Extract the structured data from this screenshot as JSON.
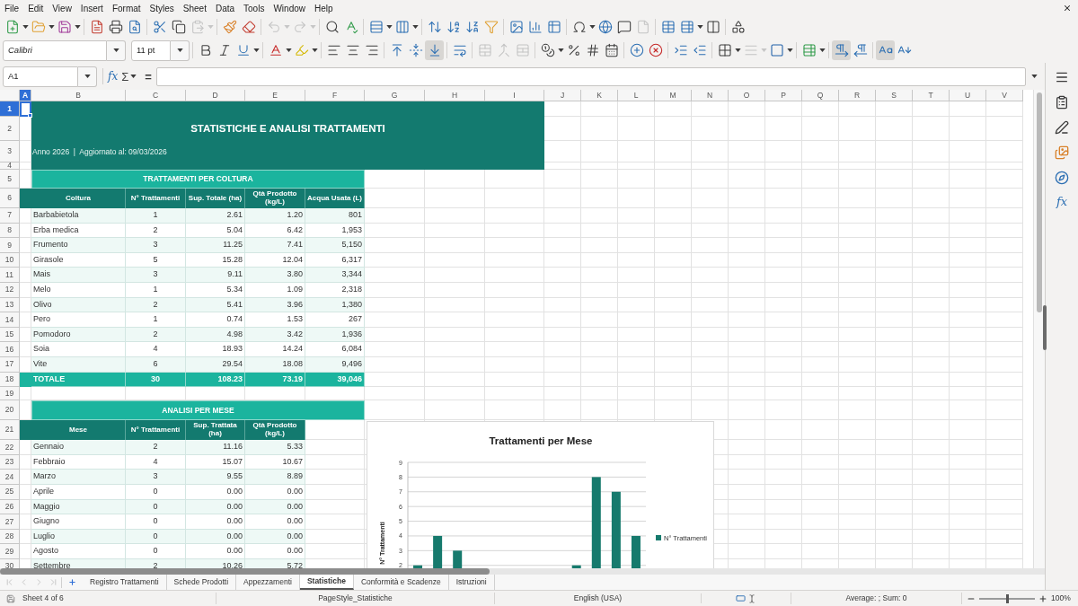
{
  "menu_bar": {
    "items": [
      "File",
      "Edit",
      "View",
      "Insert",
      "Format",
      "Styles",
      "Sheet",
      "Data",
      "Tools",
      "Window",
      "Help"
    ]
  },
  "standard_toolbar": {
    "paste_disabled": true,
    "undo_disabled": true,
    "redo_disabled": true,
    "header_footer_disabled": true
  },
  "formatting_toolbar": {
    "font_name": "Calibri",
    "font_size": "11 pt",
    "align_top_pressed": false,
    "align_center_pressed": false,
    "align_bottom_pressed": true,
    "merge_disabled": true,
    "border_style_disabled": true,
    "left_to_right_pressed": true,
    "right_to_left_pressed": false,
    "horizontal_text_pressed": true,
    "vertical_text_pressed": false
  },
  "formula_bar": {
    "name_box": "A1",
    "function_wizard": "fx",
    "sum": "Σ",
    "equals": "="
  },
  "sidebar": {
    "functions": "fx"
  },
  "column_headers": [
    {
      "label": "A",
      "selected": true
    },
    {
      "label": "B",
      "selected": false
    },
    {
      "label": "C",
      "selected": false
    },
    {
      "label": "D",
      "selected": false
    },
    {
      "label": "E",
      "selected": false
    },
    {
      "label": "F",
      "selected": false
    },
    {
      "label": "G",
      "selected": false
    },
    {
      "label": "H",
      "selected": false
    },
    {
      "label": "I",
      "selected": false
    },
    {
      "label": "J",
      "selected": false
    },
    {
      "label": "K",
      "selected": false
    },
    {
      "label": "L",
      "selected": false
    },
    {
      "label": "M",
      "selected": false
    },
    {
      "label": "N",
      "selected": false
    },
    {
      "label": "O",
      "selected": false
    },
    {
      "label": "P",
      "selected": false
    },
    {
      "label": "Q",
      "selected": false
    },
    {
      "label": "R",
      "selected": false
    },
    {
      "label": "S",
      "selected": false
    },
    {
      "label": "T",
      "selected": false
    },
    {
      "label": "U",
      "selected": false
    },
    {
      "label": "V",
      "selected": false
    }
  ],
  "row_headers": [
    {
      "label": "1",
      "selected": true
    },
    {
      "label": "2",
      "selected": false
    },
    {
      "label": "3",
      "selected": false
    },
    {
      "label": "4",
      "selected": false
    },
    {
      "label": "5",
      "selected": false
    },
    {
      "label": "6",
      "selected": false
    },
    {
      "label": "7",
      "selected": false
    },
    {
      "label": "8",
      "selected": false
    },
    {
      "label": "9",
      "selected": false
    },
    {
      "label": "10",
      "selected": false
    },
    {
      "label": "11",
      "selected": false
    },
    {
      "label": "12",
      "selected": false
    },
    {
      "label": "13",
      "selected": false
    },
    {
      "label": "14",
      "selected": false
    },
    {
      "label": "15",
      "selected": false
    },
    {
      "label": "16",
      "selected": false
    },
    {
      "label": "17",
      "selected": false
    },
    {
      "label": "18",
      "selected": false
    },
    {
      "label": "19",
      "selected": false
    },
    {
      "label": "20",
      "selected": false
    },
    {
      "label": "21",
      "selected": false
    },
    {
      "label": "22",
      "selected": false
    },
    {
      "label": "23",
      "selected": false
    },
    {
      "label": "24",
      "selected": false
    },
    {
      "label": "25",
      "selected": false
    },
    {
      "label": "26",
      "selected": false
    },
    {
      "label": "27",
      "selected": false
    },
    {
      "label": "28",
      "selected": false
    },
    {
      "label": "29",
      "selected": false
    },
    {
      "label": "30",
      "selected": false
    }
  ],
  "sheet": {
    "title": "STATISTICHE E ANALISI TRATTAMENTI",
    "subtitle": "Anno 2026  |  Aggiornato al: 09/03/2026",
    "crop_table": {
      "title": "TRATTAMENTI PER COLTURA",
      "columns": [
        "Coltura",
        "N° Trattamenti",
        "Sup. Totale (ha)",
        "Qtà Prodotto (kg/L)",
        "Acqua Usata (L)"
      ],
      "rows": [
        [
          "Barbabietola",
          "1",
          "2.61",
          "1.20",
          "801"
        ],
        [
          "Erba medica",
          "2",
          "5.04",
          "6.42",
          "1,953"
        ],
        [
          "Frumento",
          "3",
          "11.25",
          "7.41",
          "5,150"
        ],
        [
          "Girasole",
          "5",
          "15.28",
          "12.04",
          "6,317"
        ],
        [
          "Mais",
          "3",
          "9.11",
          "3.80",
          "3,344"
        ],
        [
          "Melo",
          "1",
          "5.34",
          "1.09",
          "2,318"
        ],
        [
          "Olivo",
          "2",
          "5.41",
          "3.96",
          "1,380"
        ],
        [
          "Pero",
          "1",
          "0.74",
          "1.53",
          "267"
        ],
        [
          "Pomodoro",
          "2",
          "4.98",
          "3.42",
          "1,936"
        ],
        [
          "Soia",
          "4",
          "18.93",
          "14.24",
          "6,084"
        ],
        [
          "Vite",
          "6",
          "29.54",
          "18.08",
          "9,496"
        ]
      ],
      "total": [
        "TOTALE",
        "30",
        "108.23",
        "73.19",
        "39,046"
      ]
    },
    "month_table": {
      "title": "ANALISI PER MESE",
      "columns": [
        "Mese",
        "N° Trattamenti",
        "Sup. Trattata (ha)",
        "Qtà Prodotto (kg/L)"
      ],
      "rows": [
        [
          "Gennaio",
          "2",
          "11.16",
          "5.33"
        ],
        [
          "Febbraio",
          "4",
          "15.07",
          "10.67"
        ],
        [
          "Marzo",
          "3",
          "9.55",
          "8.89"
        ],
        [
          "Aprile",
          "0",
          "0.00",
          "0.00"
        ],
        [
          "Maggio",
          "0",
          "0.00",
          "0.00"
        ],
        [
          "Giugno",
          "0",
          "0.00",
          "0.00"
        ],
        [
          "Luglio",
          "0",
          "0.00",
          "0.00"
        ],
        [
          "Agosto",
          "0",
          "0.00",
          "0.00"
        ],
        [
          "Settembre",
          "2",
          "10.26",
          "5.72"
        ]
      ]
    },
    "chart": {
      "chart_data": {
        "type": "bar",
        "title": "Trattamenti per Mese",
        "ylabel": "N° Trattamenti",
        "ylim": [
          1.8,
          9
        ],
        "yticks": [
          2,
          3,
          4,
          5,
          6,
          7,
          8,
          9
        ],
        "grid": true,
        "series": [
          {
            "name": "N° Trattamenti",
            "color": "#167a6d",
            "values": [
              2,
              4,
              3,
              null,
              null,
              null,
              null,
              null,
              2,
              8,
              7,
              4
            ]
          }
        ]
      }
    }
  },
  "sheet_tabs": {
    "scroll_buttons_disabled": true,
    "tabs": [
      {
        "label": "Registro Trattamenti",
        "selected": false
      },
      {
        "label": "Schede Prodotti",
        "selected": false
      },
      {
        "label": "Appezzamenti",
        "selected": false
      },
      {
        "label": "Statistiche",
        "selected": true
      },
      {
        "label": "Conformità e Scadenze",
        "selected": false
      },
      {
        "label": "Istruzioni",
        "selected": false
      }
    ]
  },
  "status_bar": {
    "sheet": "Sheet 4 of 6",
    "page_style": "PageStyle_Statistiche",
    "language": "English (USA)",
    "selection_summary": "Average: ; Sum: 0",
    "zoom": {
      "level": 0.5,
      "reading": "100%"
    }
  }
}
